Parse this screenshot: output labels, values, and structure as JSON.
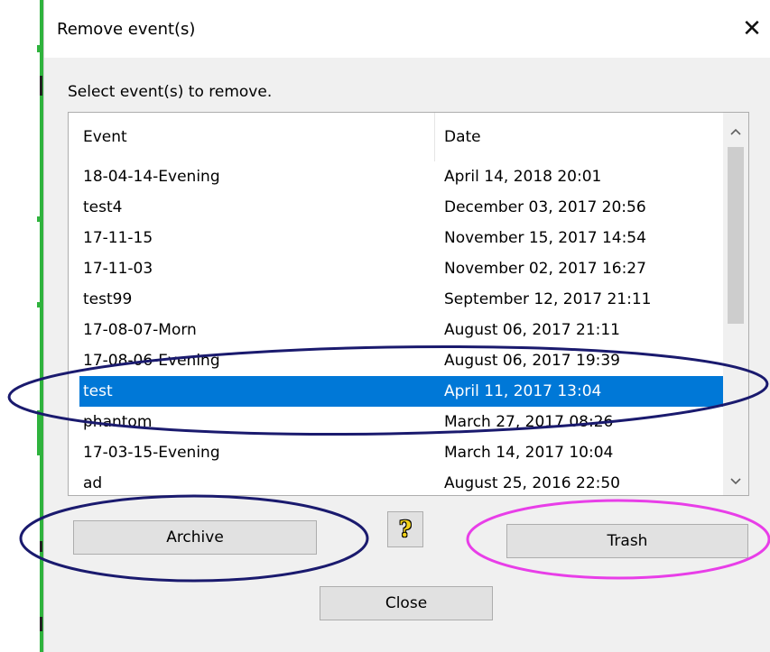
{
  "dialog": {
    "title": "Remove event(s)",
    "close_glyph": "✕",
    "instruction": "Select event(s) to remove."
  },
  "list": {
    "columns": {
      "event": "Event",
      "date": "Date"
    },
    "rows": [
      {
        "event": "18-04-14-Evening",
        "date": "April 14, 2018 20:01"
      },
      {
        "event": "test4",
        "date": "December 03, 2017 20:56"
      },
      {
        "event": "17-11-15",
        "date": "November 15, 2017 14:54"
      },
      {
        "event": "17-11-03",
        "date": "November 02, 2017 16:27"
      },
      {
        "event": "test99",
        "date": "September 12, 2017 21:11"
      },
      {
        "event": "17-08-07-Morn",
        "date": "August 06, 2017 21:11"
      },
      {
        "event": "17-08-06-Evening",
        "date": "August 06, 2017 19:39"
      },
      {
        "event": "test",
        "date": "April 11, 2017 13:04",
        "selected": true
      },
      {
        "event": "phantom",
        "date": "March 27, 2017 08:26"
      },
      {
        "event": "17-03-15-Evening",
        "date": "March 14, 2017 10:04"
      },
      {
        "event": "ad",
        "date": "August 25, 2016 22:50"
      }
    ],
    "scroll_up_icon": "chevron-up-icon",
    "scroll_down_icon": "chevron-down-icon"
  },
  "buttons": {
    "archive": "Archive",
    "help": "?",
    "trash": "Trash",
    "close": "Close"
  },
  "colors": {
    "selection": "#0078d7",
    "annotation_blue": "#1a1a6e",
    "annotation_magenta": "#e83ee8",
    "background_strip": "#2fb33d"
  }
}
